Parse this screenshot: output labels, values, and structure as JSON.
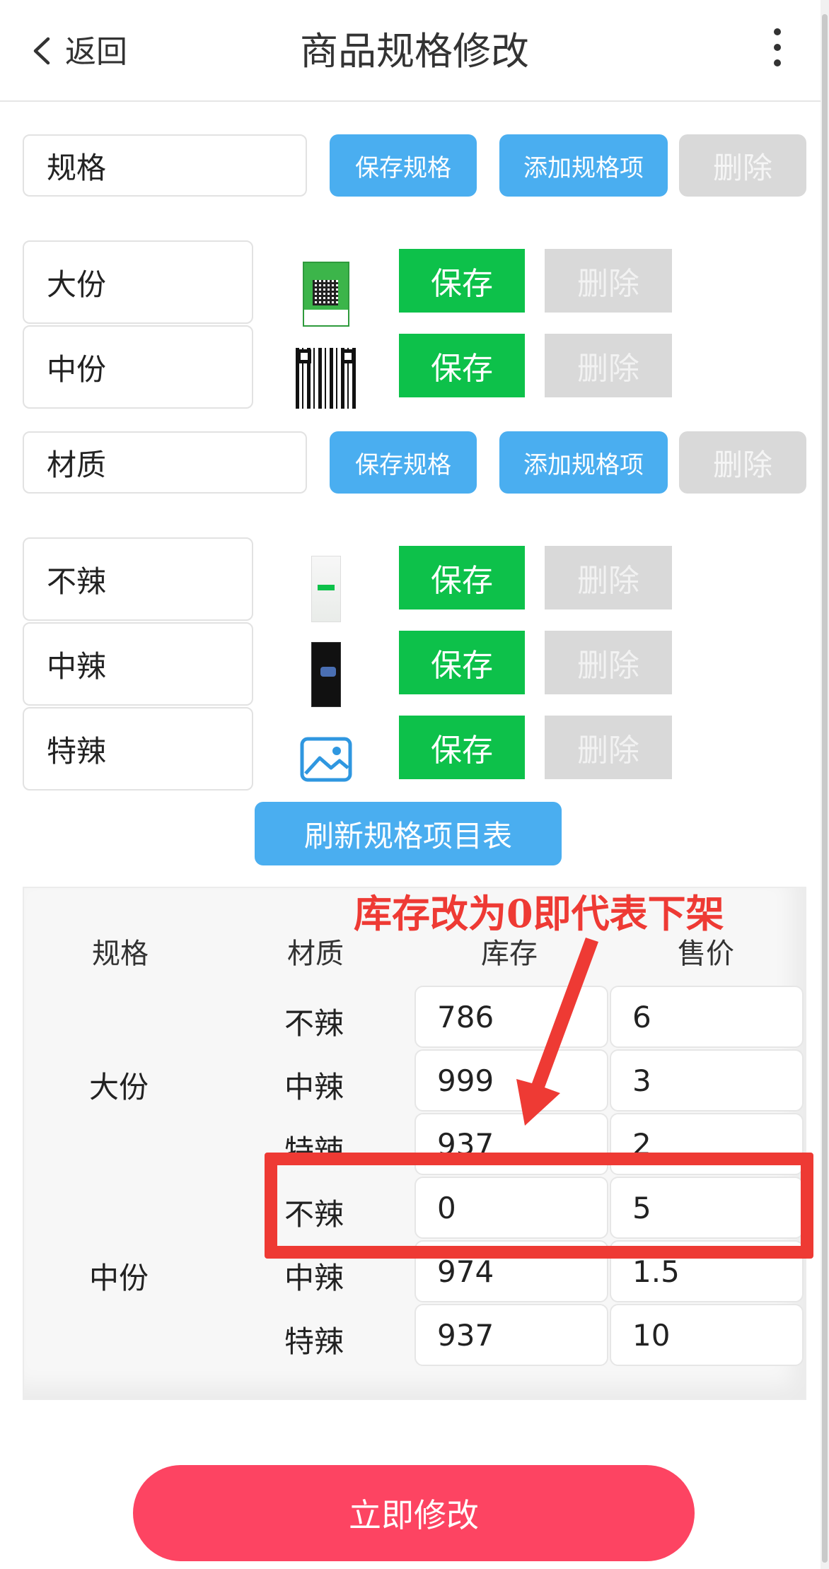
{
  "header": {
    "back_label": "返回",
    "title": "商品规格修改"
  },
  "spec_groups": [
    {
      "name": "规格",
      "save_label": "保存规格",
      "add_label": "添加规格项",
      "delete_label": "删除",
      "items": [
        {
          "name": "大份",
          "thumbnail": "wechat-pay-qr-image",
          "save_label": "保存",
          "delete_label": "删除"
        },
        {
          "name": "中份",
          "thumbnail": "qr-code-image",
          "save_label": "保存",
          "delete_label": "删除"
        }
      ]
    },
    {
      "name": "材质",
      "save_label": "保存规格",
      "add_label": "添加规格项",
      "delete_label": "删除",
      "items": [
        {
          "name": "不辣",
          "thumbnail": "light-screenshot-image",
          "save_label": "保存",
          "delete_label": "删除"
        },
        {
          "name": "中辣",
          "thumbnail": "dark-screenshot-image",
          "save_label": "保存",
          "delete_label": "删除"
        },
        {
          "name": "特辣",
          "thumbnail": "image-placeholder-icon",
          "save_label": "保存",
          "delete_label": "删除"
        }
      ]
    }
  ],
  "refresh_label": "刷新规格项目表",
  "table": {
    "headers": [
      "规格",
      "材质",
      "库存",
      "售价"
    ],
    "groups": [
      {
        "spec": "大份",
        "rows": [
          {
            "material": "不辣",
            "stock": "786",
            "price": "6"
          },
          {
            "material": "中辣",
            "stock": "999",
            "price": "3"
          },
          {
            "material": "特辣",
            "stock": "937",
            "price": "2"
          }
        ]
      },
      {
        "spec": "中份",
        "rows": [
          {
            "material": "不辣",
            "stock": "0",
            "price": "5"
          },
          {
            "material": "中辣",
            "stock": "974",
            "price": "1.5"
          },
          {
            "material": "特辣",
            "stock": "937",
            "price": "10"
          }
        ]
      }
    ]
  },
  "annotation": "库存改为0即代表下架",
  "submit_label": "立即修改",
  "colors": {
    "blue": "#4aaef0",
    "green": "#0dc14a",
    "gray": "#d9d9d9",
    "red_annotation": "#ee3a34",
    "pink_submit": "#fd4462"
  }
}
